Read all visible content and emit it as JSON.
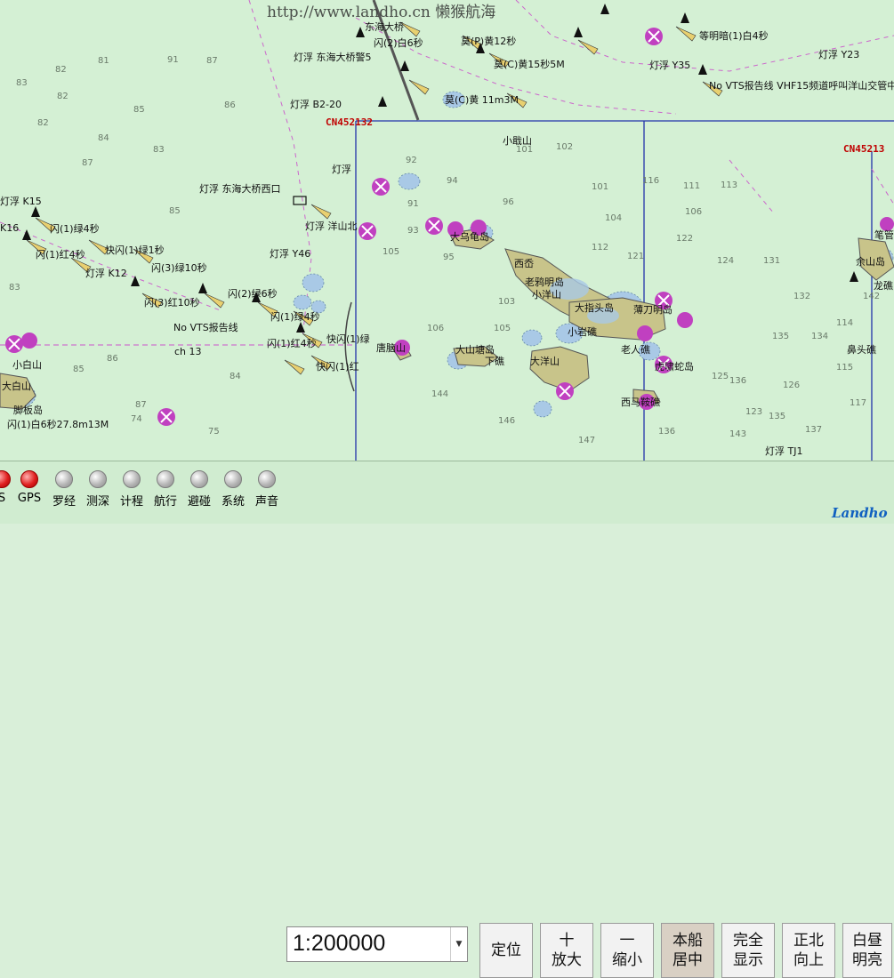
{
  "map": {
    "watermark": "http://www.landho.cn 懒猴航海",
    "cell_ids": [
      "CN452132",
      "CN45213"
    ],
    "place_labels": [
      {
        "text": "大乌龟岛"
      },
      {
        "text": "西岙"
      },
      {
        "text": "老鸦明岛"
      },
      {
        "text": "小洋山"
      },
      {
        "text": "大指头岛"
      },
      {
        "text": "薄刀明岛"
      },
      {
        "text": "小岩礁"
      },
      {
        "text": "大山塘岛"
      },
      {
        "text": "下礁"
      },
      {
        "text": "大洋山"
      },
      {
        "text": "老人礁"
      },
      {
        "text": "虎啸蛇岛"
      },
      {
        "text": "西马鞍礁"
      },
      {
        "text": "唐脑山"
      },
      {
        "text": "小白山"
      },
      {
        "text": "大白山"
      },
      {
        "text": "脚板岛"
      },
      {
        "text": "小戢山"
      },
      {
        "text": "鼻头礁"
      },
      {
        "text": "余山岛"
      },
      {
        "text": "笔管"
      },
      {
        "text": "龙礁"
      }
    ],
    "aid_labels": [
      {
        "text": "灯浮 东海大桥西口"
      },
      {
        "text": "灯浮 东海大桥警5"
      },
      {
        "text": "灯浮 B2-20"
      },
      {
        "text": "灯浮 Y46"
      },
      {
        "text": "灯浮 K12"
      },
      {
        "text": "灯浮 K15"
      },
      {
        "text": "K16"
      },
      {
        "text": "灯浮 Y35"
      },
      {
        "text": "灯浮 Y23"
      },
      {
        "text": "灯浮 TJ1"
      },
      {
        "text": "灯浮"
      },
      {
        "text": "东海大桥"
      },
      {
        "text": "No VTS报告线"
      },
      {
        "text": "No VTS报告线 VHF15频道呼叫洋山交管中心"
      },
      {
        "text": "闪(1)绿4秒"
      },
      {
        "text": "快闪(1)绿1秒"
      },
      {
        "text": "闪(1)红4秒"
      },
      {
        "text": "闪(3)绿10秒"
      },
      {
        "text": "闪(3)红10秒"
      },
      {
        "text": "闪(2)绿6秒"
      },
      {
        "text": "闪(1)绿4秒"
      },
      {
        "text": "快闪(1)绿"
      },
      {
        "text": "闪(1)红4秒"
      },
      {
        "text": "快闪(1)红"
      },
      {
        "text": "等明暗(1)白4秒"
      },
      {
        "text": "莫(P)黄12秒"
      },
      {
        "text": "莫(C)黄15秒5M"
      },
      {
        "text": "闪(1)白6秒27.8m13M"
      },
      {
        "text": "闪(2)白6秒"
      },
      {
        "text": "灯浮 洋山北"
      },
      {
        "text": "ch 13"
      },
      {
        "text": "莫(C)黄 11m3M"
      }
    ],
    "soundings": [
      "82",
      "81",
      "82",
      "91",
      "87",
      "82",
      "83",
      "85",
      "84",
      "87",
      "83",
      "86",
      "92",
      "94",
      "102",
      "91",
      "101",
      "93",
      "95",
      "96",
      "103",
      "105",
      "106",
      "121",
      "124",
      "132",
      "135",
      "144",
      "146",
      "112",
      "122",
      "131",
      "134",
      "136",
      "115",
      "101",
      "116",
      "106",
      "104",
      "85",
      "87",
      "84",
      "86",
      "74",
      "75",
      "83",
      "85",
      "105",
      "114",
      "117",
      "123",
      "126",
      "125",
      "135",
      "137",
      "143",
      "147",
      "136",
      "142",
      "111",
      "113"
    ]
  },
  "status_indicators": [
    {
      "label": "S",
      "color": "red"
    },
    {
      "label": "GPS",
      "color": "red"
    },
    {
      "label": "罗经",
      "color": "gray"
    },
    {
      "label": "测深",
      "color": "gray"
    },
    {
      "label": "计程",
      "color": "gray"
    },
    {
      "label": "航行",
      "color": "gray"
    },
    {
      "label": "避碰",
      "color": "gray"
    },
    {
      "label": "系统",
      "color": "gray"
    },
    {
      "label": "声音",
      "color": "gray"
    }
  ],
  "scale": {
    "value": "1:200000"
  },
  "buttons": [
    {
      "label": "定位"
    },
    {
      "label": "十\n放大"
    },
    {
      "label": "一\n缩小"
    },
    {
      "label": "本船\n居中"
    },
    {
      "label": "完全\n显示"
    },
    {
      "label": "正北\n向上"
    },
    {
      "label": "白昼\n明亮"
    }
  ],
  "logo": "Landho",
  "colors": {
    "sea": "#d4f0d4",
    "land": "#c8c48a",
    "shallow": "#a9c9e6",
    "magenta": "#c040c0",
    "cell_border": "#2233aa"
  }
}
